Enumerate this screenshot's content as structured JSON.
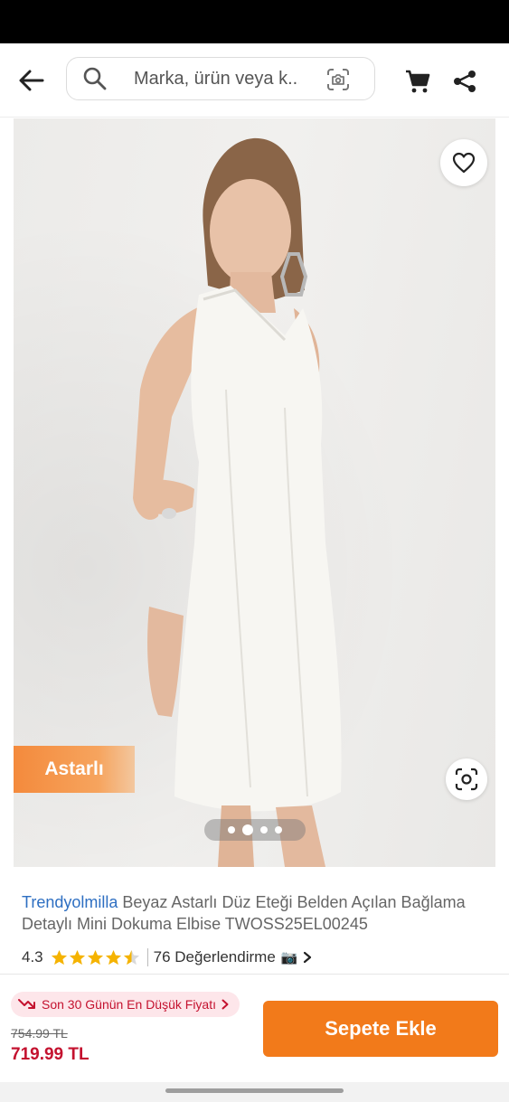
{
  "header": {
    "search": {
      "placeholder": "Marka, ürün veya k...",
      "icon": "search-icon",
      "camera_icon": "camera-search-icon"
    },
    "icons": {
      "back": "back-arrow-icon",
      "cart": "cart-icon",
      "share": "share-icon"
    }
  },
  "gallery": {
    "badge_label": "Astarlı",
    "dots": 4,
    "active_dot_index": 1,
    "icons": {
      "favorite": "heart-icon",
      "visual_search": "visual-search-icon"
    }
  },
  "product": {
    "brand": "Trendyolmilla",
    "title": "Beyaz Astarlı Düz Eteği Belden Açılan Bağlama Detaylı Mini Dokuma Elbise TWOSS25EL00245",
    "rating": "4.3",
    "rating_value": 4.3,
    "reviews_label": "76 Değerlendirme",
    "reviews_icon": "📷"
  },
  "pricing": {
    "lowest_price_label": "Son 30 Günün En Düşük Fiyatı",
    "old_price": "754.99 TL",
    "current_price": "719.99 TL",
    "add_to_cart_label": "Sepete Ekle"
  },
  "colors": {
    "accent_orange": "#f27a1a",
    "brand_blue": "#2e6fc2",
    "price_red": "#c4122f",
    "star_yellow": "#f5b301"
  }
}
